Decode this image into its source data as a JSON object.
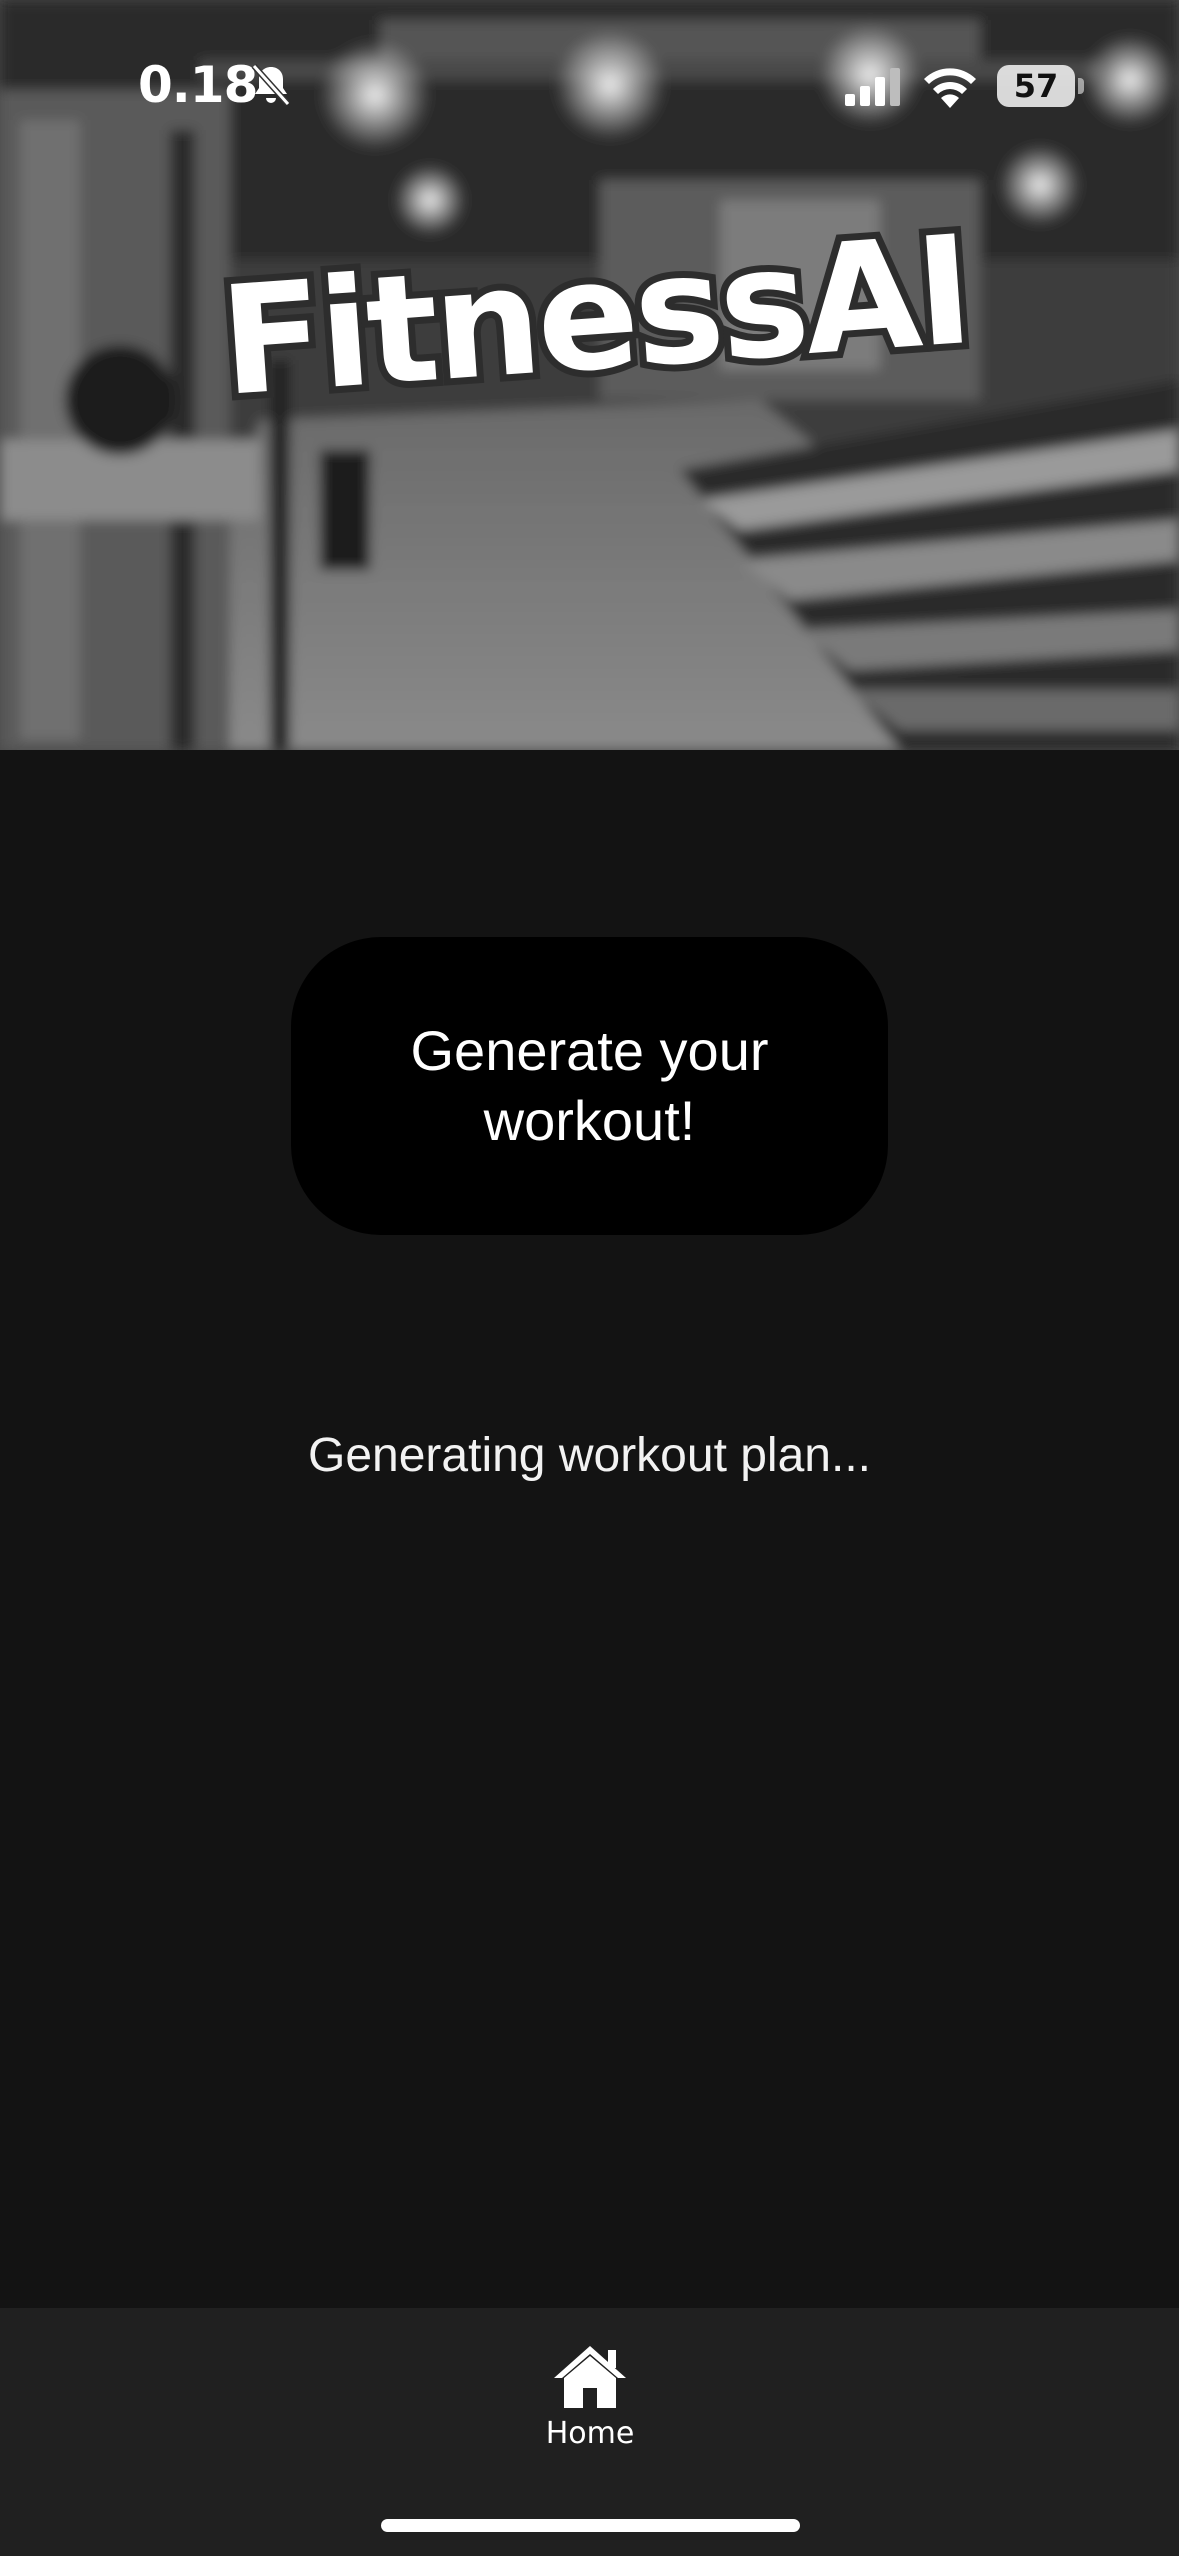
{
  "status_bar": {
    "time": "0.18",
    "battery_level": "57",
    "icons": [
      "bell-muted-icon",
      "cellular-signal-icon",
      "wifi-icon",
      "battery-icon"
    ]
  },
  "header": {
    "logo_text": "FitnessAI",
    "background": "gym-photo-grayscale"
  },
  "main": {
    "generate_button_label": "Generate your workout!",
    "status_message": "Generating workout plan..."
  },
  "tab_bar": {
    "tabs": [
      {
        "label": "Home",
        "icon": "home-icon",
        "selected": true
      }
    ]
  },
  "colors": {
    "background": "#131313",
    "button": "#000000",
    "tab_bar": "#202020",
    "text": "#ffffff"
  }
}
